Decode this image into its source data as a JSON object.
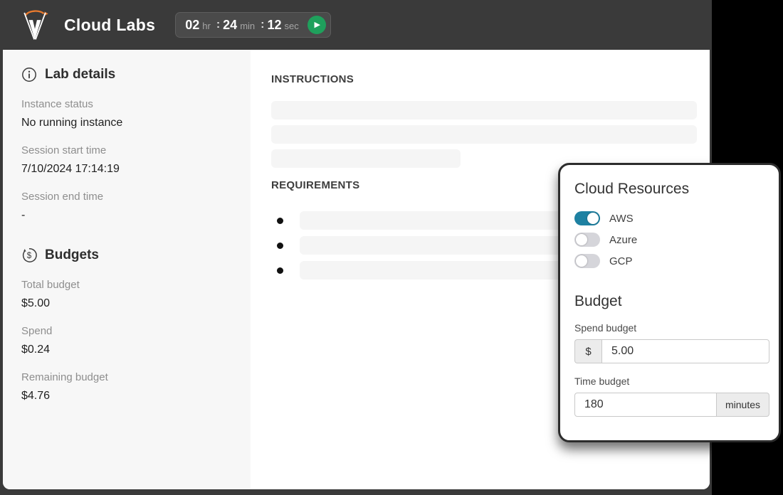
{
  "header": {
    "title": "Cloud Labs",
    "timer": {
      "hours": "02",
      "hours_unit": "hr",
      "minutes": "24",
      "minutes_unit": "min",
      "seconds": "12",
      "seconds_unit": "sec",
      "separator": ":"
    },
    "colors": {
      "bar_bg": "#3a3a3a",
      "chip_bg": "#4a4a4a",
      "play_green": "#1fa05c",
      "logo_orange": "#e87a2e"
    }
  },
  "sidebar": {
    "lab_details": {
      "heading": "Lab details",
      "icon": "info-circle-icon",
      "fields": [
        {
          "label": "Instance status",
          "value": "No running instance"
        },
        {
          "label": "Session start time",
          "value": "7/10/2024 17:14:19"
        },
        {
          "label": "Session end time",
          "value": "-"
        }
      ]
    },
    "budgets": {
      "heading": "Budgets",
      "icon": "dollar-circle-icon",
      "fields": [
        {
          "label": "Total budget",
          "value": "$5.00"
        },
        {
          "label": "Spend",
          "value": "$0.24"
        },
        {
          "label": "Remaining budget",
          "value": "$4.76"
        }
      ]
    }
  },
  "main": {
    "instructions_heading": "INSTRUCTIONS",
    "requirements_heading": "REQUIREMENTS",
    "instructions_placeholder_lines": 3,
    "requirements_placeholder_items": 3
  },
  "panel": {
    "title": "Cloud Resources",
    "toggles": [
      {
        "label": "AWS",
        "on": true
      },
      {
        "label": "Azure",
        "on": false
      },
      {
        "label": "GCP",
        "on": false
      }
    ],
    "budget": {
      "heading": "Budget",
      "spend": {
        "label": "Spend budget",
        "prefix": "$",
        "value": "5.00"
      },
      "time": {
        "label": "Time budget",
        "value": "180",
        "suffix": "minutes"
      }
    },
    "accent_color": "#1e81a2"
  }
}
